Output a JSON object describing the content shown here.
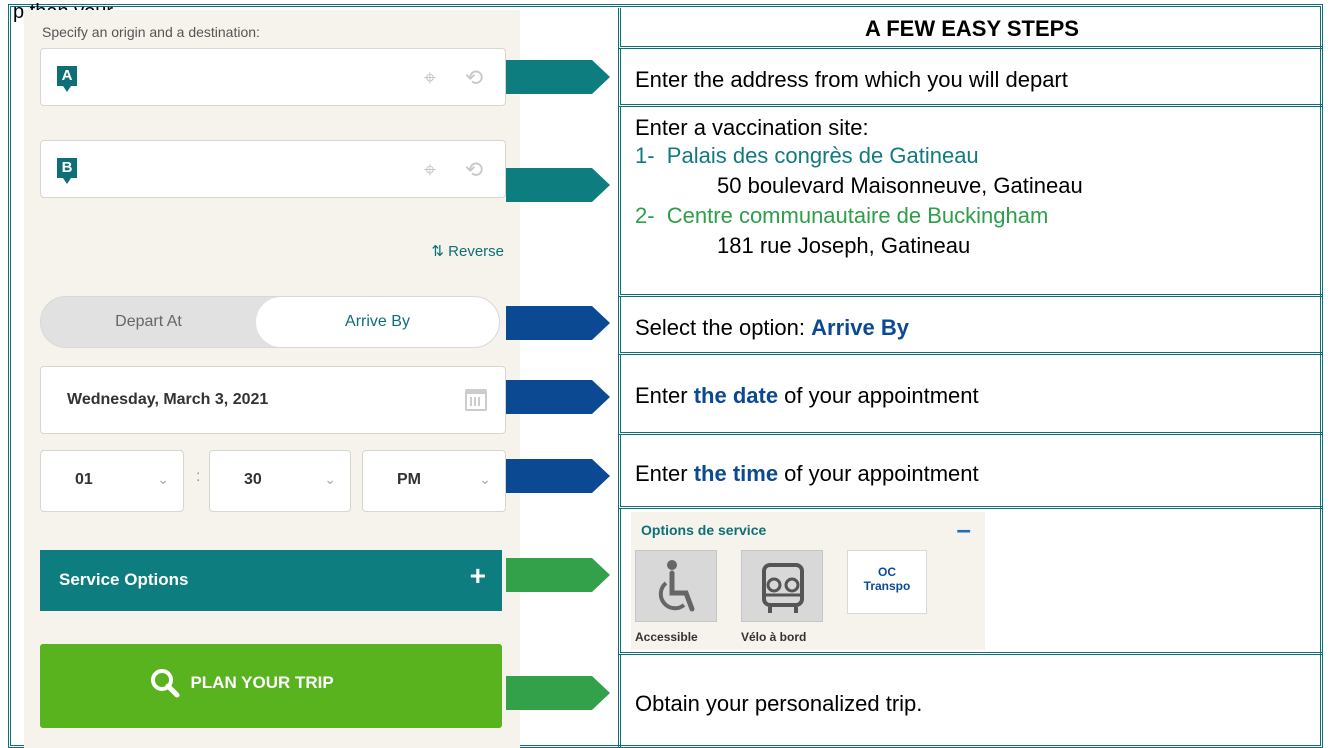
{
  "top_text": "p than your",
  "panel": {
    "origin_destination_label": "Specify an origin and a destination:",
    "origin_pin": "A",
    "destination_pin": "B",
    "reverse_label": "Reverse",
    "toggle": {
      "depart": "Depart At",
      "arrive": "Arrive By"
    },
    "date": "Wednesday, March 3, 2021",
    "time": {
      "hour": "01",
      "minute": "30",
      "ampm": "PM"
    },
    "service_options_label": "Service Options",
    "plan_label": "PLAN YOUR TRIP"
  },
  "steps": {
    "header": "A FEW EASY STEPS",
    "step1": "Enter the address from which you will depart",
    "step2_intro": "Enter a vaccination site:",
    "site1_num": "1-",
    "site1_name": "Palais des congrès de Gatineau",
    "site1_addr": "50 boulevard Maisonneuve, Gatineau",
    "site2_num": "2-",
    "site2_name": "Centre communautaire de Buckingham",
    "site2_addr": "181 rue Joseph, Gatineau",
    "step3_prefix": "Select the option: ",
    "step3_em": "Arrive By",
    "step4_prefix": "Enter ",
    "step4_em": "the date",
    "step4_suffix": " of your appointment",
    "step5_prefix": "Enter ",
    "step5_em": "the time",
    "step5_suffix": " of your appointment",
    "options_title": "Options de service",
    "options_minus": "–",
    "opt_accessible": "Accessible",
    "opt_velo": "Vélo à bord",
    "opt_oc_line1": "OC",
    "opt_oc_line2": "Transpo",
    "step7": "Obtain your personalized trip."
  },
  "colors": {
    "teal": "#0e7d7f",
    "navy": "#0b4a93",
    "green": "#33a04a",
    "plan_green": "#59b31f"
  }
}
